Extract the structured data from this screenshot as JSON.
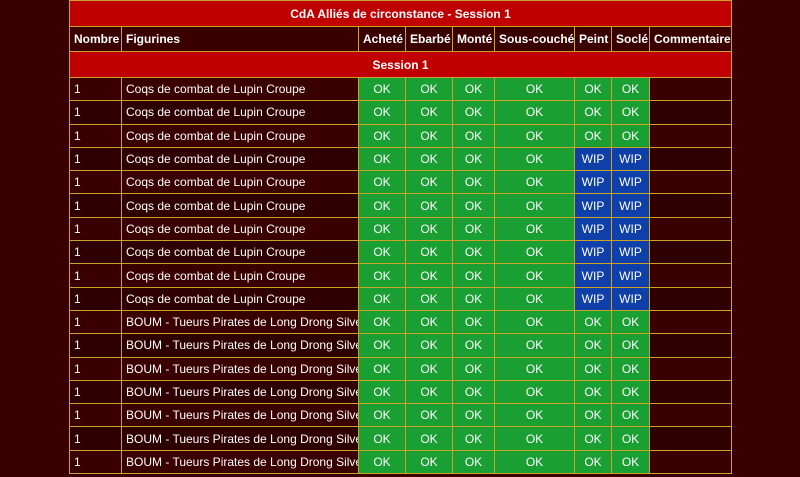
{
  "table": {
    "title": "CdA Alliés de circonstance - Session 1",
    "headers": [
      "Nombre",
      "Figurines",
      "Acheté",
      "Ebarbé",
      "Monté",
      "Sous-couché",
      "Peint",
      "Soclé",
      "Commentaire"
    ],
    "session_label": "Session 1",
    "rows": [
      {
        "nombre": "1",
        "figurine": "Coqs de combat de Lupin Croupe",
        "achete": "OK",
        "ebarbe": "OK",
        "monte": "OK",
        "sous_couche": "OK",
        "peint": "OK",
        "socle": "OK",
        "commentaire": ""
      },
      {
        "nombre": "1",
        "figurine": "Coqs de combat de Lupin Croupe",
        "achete": "OK",
        "ebarbe": "OK",
        "monte": "OK",
        "sous_couche": "OK",
        "peint": "OK",
        "socle": "OK",
        "commentaire": ""
      },
      {
        "nombre": "1",
        "figurine": "Coqs de combat de Lupin Croupe",
        "achete": "OK",
        "ebarbe": "OK",
        "monte": "OK",
        "sous_couche": "OK",
        "peint": "OK",
        "socle": "OK",
        "commentaire": ""
      },
      {
        "nombre": "1",
        "figurine": "Coqs de combat de Lupin Croupe",
        "achete": "OK",
        "ebarbe": "OK",
        "monte": "OK",
        "sous_couche": "OK",
        "peint": "WIP",
        "socle": "WIP",
        "commentaire": ""
      },
      {
        "nombre": "1",
        "figurine": "Coqs de combat de Lupin Croupe",
        "achete": "OK",
        "ebarbe": "OK",
        "monte": "OK",
        "sous_couche": "OK",
        "peint": "WIP",
        "socle": "WIP",
        "commentaire": ""
      },
      {
        "nombre": "1",
        "figurine": "Coqs de combat de Lupin Croupe",
        "achete": "OK",
        "ebarbe": "OK",
        "monte": "OK",
        "sous_couche": "OK",
        "peint": "WIP",
        "socle": "WIP",
        "commentaire": ""
      },
      {
        "nombre": "1",
        "figurine": "Coqs de combat de Lupin Croupe",
        "achete": "OK",
        "ebarbe": "OK",
        "monte": "OK",
        "sous_couche": "OK",
        "peint": "WIP",
        "socle": "WIP",
        "commentaire": ""
      },
      {
        "nombre": "1",
        "figurine": "Coqs de combat de Lupin Croupe",
        "achete": "OK",
        "ebarbe": "OK",
        "monte": "OK",
        "sous_couche": "OK",
        "peint": "WIP",
        "socle": "WIP",
        "commentaire": ""
      },
      {
        "nombre": "1",
        "figurine": "Coqs de combat de Lupin Croupe",
        "achete": "OK",
        "ebarbe": "OK",
        "monte": "OK",
        "sous_couche": "OK",
        "peint": "WIP",
        "socle": "WIP",
        "commentaire": ""
      },
      {
        "nombre": "1",
        "figurine": "Coqs de combat de Lupin Croupe",
        "achete": "OK",
        "ebarbe": "OK",
        "monte": "OK",
        "sous_couche": "OK",
        "peint": "WIP",
        "socle": "WIP",
        "commentaire": ""
      },
      {
        "nombre": "1",
        "figurine": "BOUM - Tueurs Pirates de Long Drong Silver",
        "achete": "OK",
        "ebarbe": "OK",
        "monte": "OK",
        "sous_couche": "OK",
        "peint": "OK",
        "socle": "OK",
        "commentaire": ""
      },
      {
        "nombre": "1",
        "figurine": "BOUM - Tueurs Pirates de Long Drong Silver",
        "achete": "OK",
        "ebarbe": "OK",
        "monte": "OK",
        "sous_couche": "OK",
        "peint": "OK",
        "socle": "OK",
        "commentaire": ""
      },
      {
        "nombre": "1",
        "figurine": "BOUM - Tueurs Pirates de Long Drong Silver",
        "achete": "OK",
        "ebarbe": "OK",
        "monte": "OK",
        "sous_couche": "OK",
        "peint": "OK",
        "socle": "OK",
        "commentaire": ""
      },
      {
        "nombre": "1",
        "figurine": "BOUM - Tueurs Pirates de Long Drong Silver",
        "achete": "OK",
        "ebarbe": "OK",
        "monte": "OK",
        "sous_couche": "OK",
        "peint": "OK",
        "socle": "OK",
        "commentaire": ""
      },
      {
        "nombre": "1",
        "figurine": "BOUM - Tueurs Pirates de Long Drong Silver",
        "achete": "OK",
        "ebarbe": "OK",
        "monte": "OK",
        "sous_couche": "OK",
        "peint": "OK",
        "socle": "OK",
        "commentaire": ""
      },
      {
        "nombre": "1",
        "figurine": "BOUM - Tueurs Pirates de Long Drong Silver",
        "achete": "OK",
        "ebarbe": "OK",
        "monte": "OK",
        "sous_couche": "OK",
        "peint": "OK",
        "socle": "OK",
        "commentaire": ""
      },
      {
        "nombre": "1",
        "figurine": "BOUM - Tueurs Pirates de Long Drong Silver",
        "achete": "OK",
        "ebarbe": "OK",
        "monte": "OK",
        "sous_couche": "OK",
        "peint": "OK",
        "socle": "OK",
        "commentaire": ""
      }
    ]
  },
  "colors": {
    "background": "#3a0000",
    "title_bar": "#c00000",
    "border": "#c9a227",
    "ok": "#1aa032",
    "wip": "#0f3fa8"
  }
}
